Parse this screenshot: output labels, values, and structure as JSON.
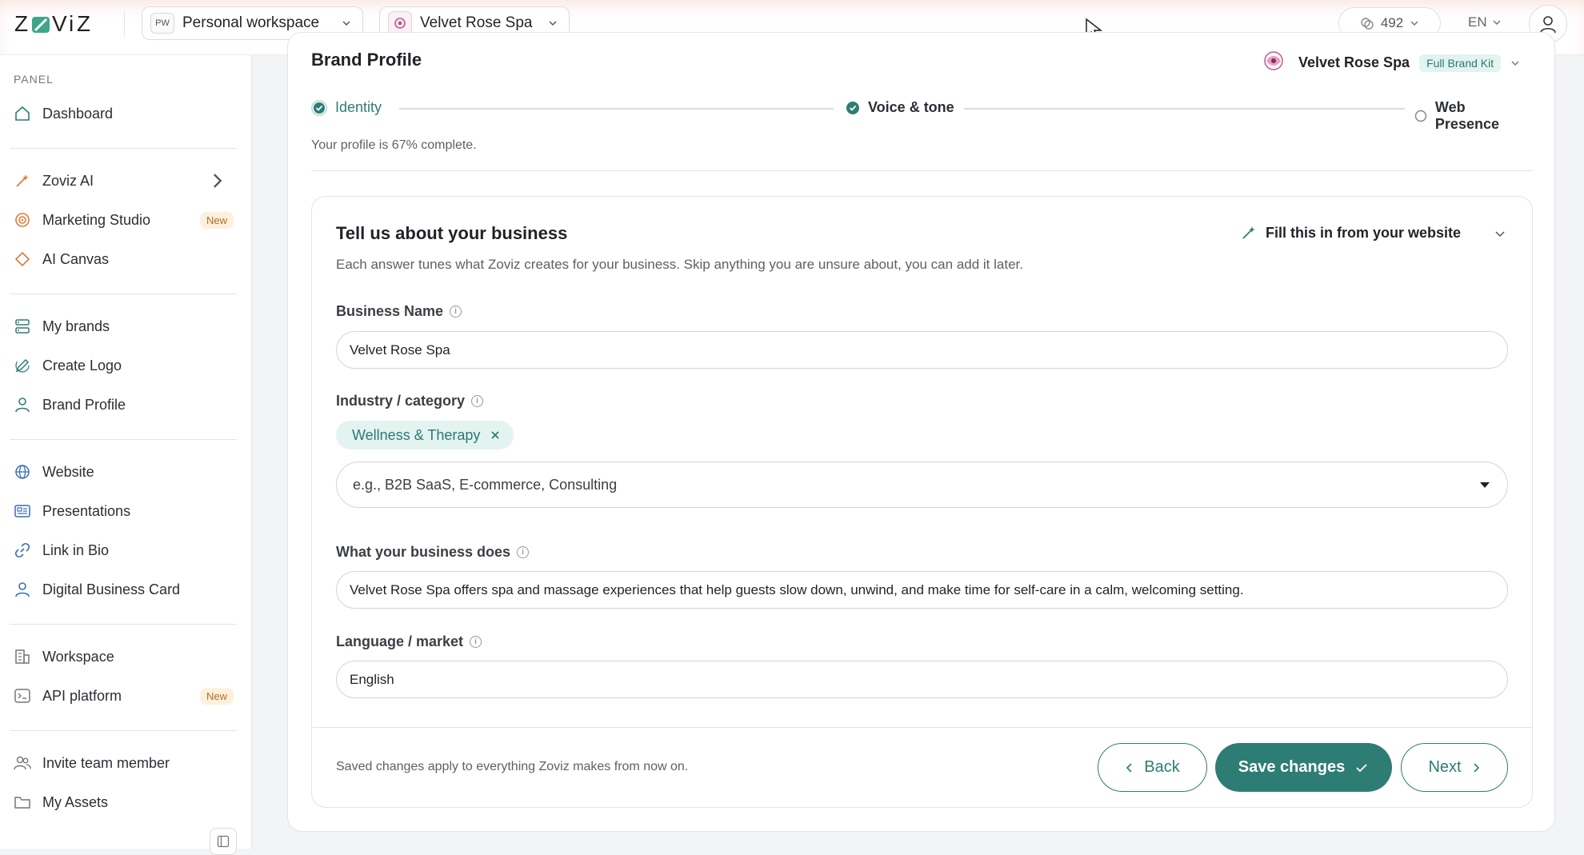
{
  "topbar": {
    "logo_text": "ZOVIZ",
    "workspace_badge": "PW",
    "workspace_name": "Personal workspace",
    "brand_name": "Velvet Rose Spa",
    "credits": "492",
    "language": "EN"
  },
  "sidebar": {
    "panel_label": "PANEL",
    "items": [
      {
        "label": "Dashboard",
        "icon": "home-icon"
      },
      {
        "label": "Zoviz AI",
        "icon": "magic-wand-icon"
      },
      {
        "label": "Marketing Studio",
        "icon": "target-icon",
        "badge": "New"
      },
      {
        "label": "AI Canvas",
        "icon": "diamond-icon"
      },
      {
        "label": "My brands",
        "icon": "brands-icon"
      },
      {
        "label": "Create Logo",
        "icon": "pen-icon"
      },
      {
        "label": "Brand Profile",
        "icon": "user-icon"
      },
      {
        "label": "Website",
        "icon": "globe-icon"
      },
      {
        "label": "Presentations",
        "icon": "presentation-icon"
      },
      {
        "label": "Link in Bio",
        "icon": "link-icon"
      },
      {
        "label": "Digital Business Card",
        "icon": "card-user-icon"
      },
      {
        "label": "Workspace",
        "icon": "building-icon"
      },
      {
        "label": "API platform",
        "icon": "terminal-icon",
        "badge": "New"
      },
      {
        "label": "Invite team member",
        "icon": "team-icon"
      },
      {
        "label": "My Assets",
        "icon": "folder-icon"
      }
    ]
  },
  "page": {
    "title": "Brand Profile",
    "brand_name": "Velvet Rose Spa",
    "kit_badge": "Full Brand Kit",
    "steps": [
      {
        "label": "Identity",
        "status": "active"
      },
      {
        "label": "Voice & tone",
        "status": "done"
      },
      {
        "label": "Web Presence",
        "status": "pending"
      }
    ],
    "progress_text": "Your profile is 67% complete."
  },
  "form": {
    "title": "Tell us about your business",
    "fill_from_website": "Fill this in from your website",
    "subtitle": "Each answer tunes what Zoviz creates for your business. Skip anything you are unsure about, you can add it later.",
    "business_name_label": "Business Name",
    "business_name_value": "Velvet Rose Spa",
    "industry_label": "Industry / category",
    "industry_chip": "Wellness & Therapy",
    "industry_placeholder": "e.g., B2B SaaS, E-commerce, Consulting",
    "does_label": "What your business does",
    "does_value": "Velvet Rose Spa offers spa and massage experiences that help guests slow down, unwind, and make time for self-care in a calm, welcoming setting.",
    "language_label": "Language / market",
    "language_value": "English",
    "footer_note": "Saved changes apply to everything Zoviz makes from now on.",
    "back_label": "Back",
    "save_label": "Save changes",
    "next_label": "Next"
  },
  "colors": {
    "accent": "#2e7d74",
    "accent_light": "#e3f3f0",
    "badge_new_bg": "#fdf0de",
    "badge_new_text": "#b07020"
  }
}
